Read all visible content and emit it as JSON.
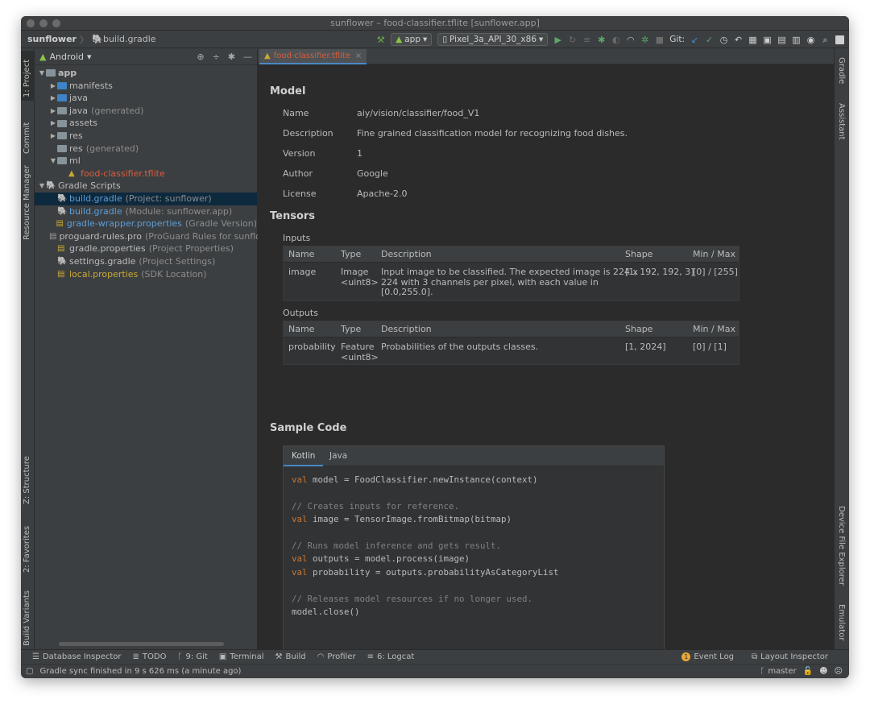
{
  "window": {
    "title": "sunflower – food-classifier.tflite [sunflower.app]"
  },
  "navbar": {
    "project": "sunflower",
    "file": "build.gradle",
    "run_config": "app",
    "device": "Pixel_3a_API_30_x86",
    "git_label": "Git:"
  },
  "project_panel": {
    "view": "Android",
    "tree": [
      {
        "label": "app",
        "extra": "",
        "level": 0,
        "arrow": "▼",
        "kind": "folder"
      },
      {
        "label": "manifests",
        "extra": "",
        "level": 1,
        "arrow": "▶",
        "kind": "folder-blue"
      },
      {
        "label": "java",
        "extra": "",
        "level": 1,
        "arrow": "▶",
        "kind": "folder-blue"
      },
      {
        "label": "java",
        "extra": "(generated)",
        "level": 1,
        "arrow": "▶",
        "kind": "folder"
      },
      {
        "label": "assets",
        "extra": "",
        "level": 1,
        "arrow": "▶",
        "kind": "folder"
      },
      {
        "label": "res",
        "extra": "",
        "level": 1,
        "arrow": "▶",
        "kind": "folder"
      },
      {
        "label": "res",
        "extra": "(generated)",
        "level": 1,
        "arrow": "",
        "kind": "folder"
      },
      {
        "label": "ml",
        "extra": "",
        "level": 1,
        "arrow": "▼",
        "kind": "folder"
      },
      {
        "label": "food-classifier.tflite",
        "extra": "",
        "level": 2,
        "arrow": "",
        "kind": "file-red"
      },
      {
        "label": "Gradle Scripts",
        "extra": "",
        "level": 0,
        "arrow": "▼",
        "kind": "gradle"
      },
      {
        "label": "build.gradle",
        "extra": "(Project: sunflower)",
        "level": 1,
        "arrow": "",
        "kind": "gradle-blue",
        "selected": true
      },
      {
        "label": "build.gradle",
        "extra": "(Module: sunflower.app)",
        "level": 1,
        "arrow": "",
        "kind": "gradle-blue"
      },
      {
        "label": "gradle-wrapper.properties",
        "extra": "(Gradle Version)",
        "level": 1,
        "arrow": "",
        "kind": "props-blue"
      },
      {
        "label": "proguard-rules.pro",
        "extra": "(ProGuard Rules for sunflo",
        "level": 1,
        "arrow": "",
        "kind": "file"
      },
      {
        "label": "gradle.properties",
        "extra": "(Project Properties)",
        "level": 1,
        "arrow": "",
        "kind": "props"
      },
      {
        "label": "settings.gradle",
        "extra": "(Project Settings)",
        "level": 1,
        "arrow": "",
        "kind": "gradle"
      },
      {
        "label": "local.properties",
        "extra": "(SDK Location)",
        "level": 1,
        "arrow": "",
        "kind": "props-yellow"
      }
    ]
  },
  "left_tabs": [
    "1: Project",
    "Commit",
    "Resource Manager",
    "Z: Structure",
    "2: Favorites",
    "Build Variants"
  ],
  "right_tabs": [
    "Gradle",
    "Assistant",
    "Device File Explorer",
    "Emulator"
  ],
  "editor": {
    "tab": "food-classifier.tflite",
    "model_heading": "Model",
    "model": [
      {
        "key": "Name",
        "value": "aiy/vision/classifier/food_V1"
      },
      {
        "key": "Description",
        "value": "Fine grained classification model for recognizing food dishes."
      },
      {
        "key": "Version",
        "value": "1"
      },
      {
        "key": "Author",
        "value": "Google"
      },
      {
        "key": "License",
        "value": "Apache-2.0"
      }
    ],
    "tensors_heading": "Tensors",
    "inputs_label": "Inputs",
    "outputs_label": "Outputs",
    "columns": [
      "Name",
      "Type",
      "Description",
      "Shape",
      "Min / Max"
    ],
    "inputs": {
      "name": "image",
      "type1": "Image",
      "type2": "<uint8>",
      "desc1": "Input image to be classified. The expected image is 224 x",
      "desc2": "224 with 3 channels per pixel, with each value in",
      "desc3": "[0.0,255.0].",
      "shape": "[1, 192, 192, 3]",
      "minmax": "[0] / [255]"
    },
    "outputs": {
      "name": "probability",
      "type1": "Feature",
      "type2": "<uint8>",
      "desc1": "Probabilities of the outputs classes.",
      "shape": "[1, 2024]",
      "minmax": "[0] / [1]"
    },
    "sample_heading": "Sample Code",
    "code_tabs": [
      "Kotlin",
      "Java"
    ]
  },
  "bottom_tools": [
    "Database Inspector",
    "TODO",
    "9: Git",
    "Terminal",
    "Build",
    "Profiler",
    "6: Logcat"
  ],
  "bottom_right_tools": [
    "Event Log",
    "Layout Inspector"
  ],
  "event_count": "1",
  "status": {
    "message": "Gradle sync finished in 9 s 626 ms (a minute ago)",
    "branch": "master"
  }
}
